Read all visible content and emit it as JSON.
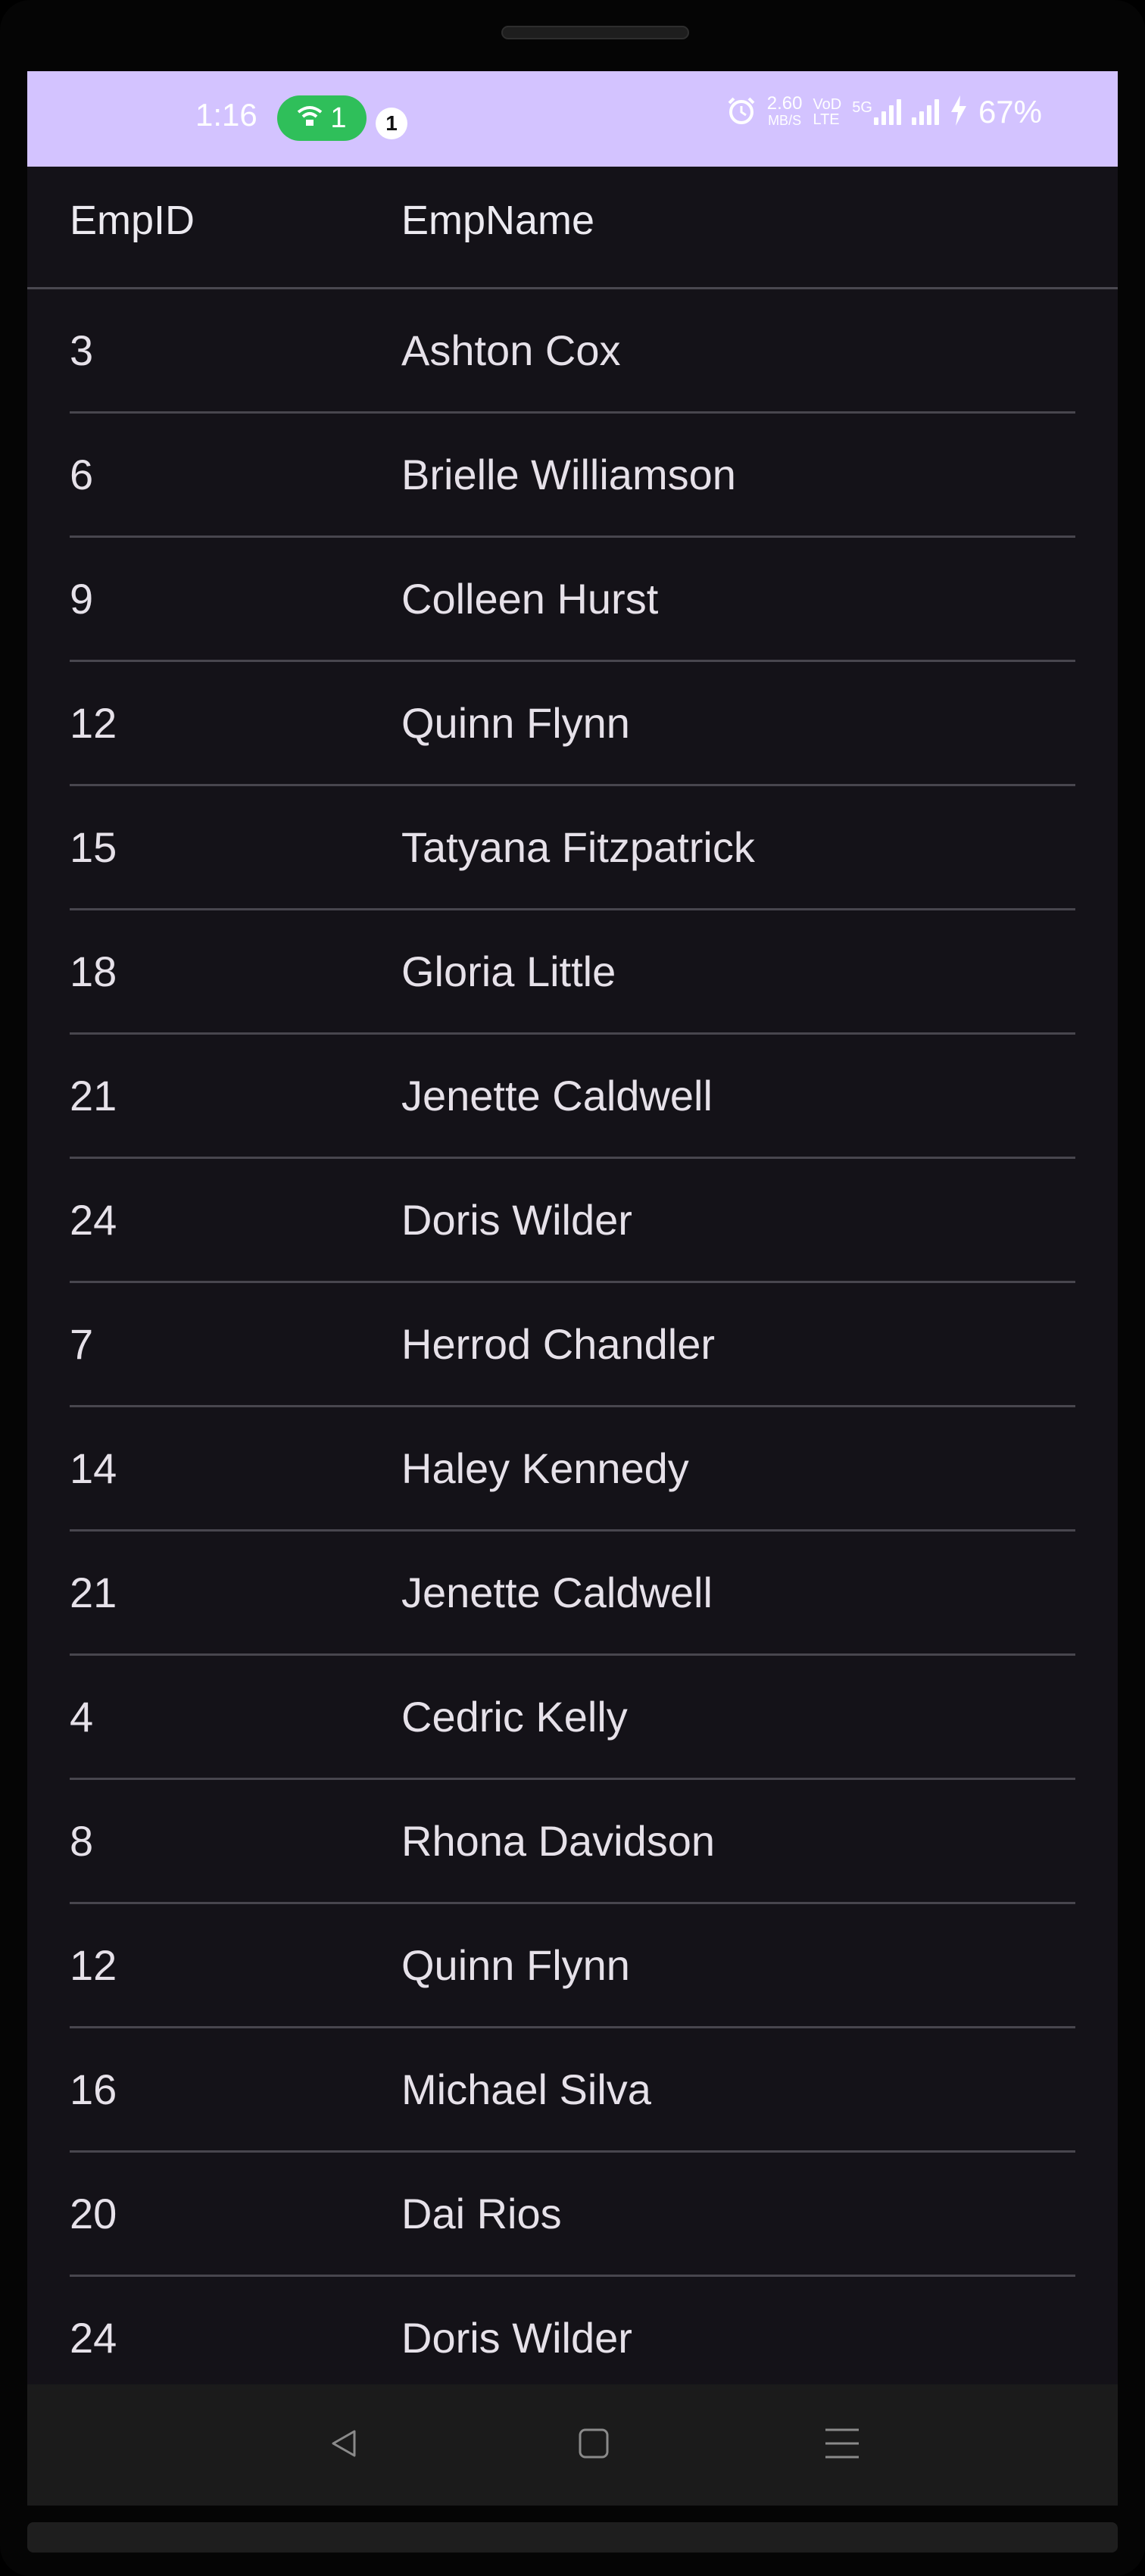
{
  "status_bar": {
    "time": "1:16",
    "wifi_count": "1",
    "notification_count": "1",
    "net_speed_value": "2.60",
    "net_speed_unit": "MB/S",
    "volte_top": "VoD",
    "volte_bottom": "LTE",
    "network_type": "5G",
    "battery": "67%"
  },
  "table": {
    "columns": [
      "EmpID",
      "EmpName"
    ],
    "rows": [
      {
        "id": "3",
        "name": "Ashton Cox"
      },
      {
        "id": "6",
        "name": "Brielle Williamson"
      },
      {
        "id": "9",
        "name": "Colleen Hurst"
      },
      {
        "id": "12",
        "name": "Quinn Flynn"
      },
      {
        "id": "15",
        "name": "Tatyana Fitzpatrick"
      },
      {
        "id": "18",
        "name": "Gloria Little"
      },
      {
        "id": "21",
        "name": "Jenette Caldwell"
      },
      {
        "id": "24",
        "name": "Doris Wilder"
      },
      {
        "id": "7",
        "name": "Herrod Chandler"
      },
      {
        "id": "14",
        "name": "Haley Kennedy"
      },
      {
        "id": "21",
        "name": "Jenette Caldwell"
      },
      {
        "id": "4",
        "name": "Cedric Kelly"
      },
      {
        "id": "8",
        "name": "Rhona Davidson"
      },
      {
        "id": "12",
        "name": "Quinn Flynn"
      },
      {
        "id": "16",
        "name": "Michael Silva"
      },
      {
        "id": "20",
        "name": "Dai Rios"
      },
      {
        "id": "24",
        "name": "Doris Wilder"
      }
    ]
  },
  "nav_bar": {
    "buttons": [
      "back-icon",
      "home-icon",
      "menu-icon"
    ]
  },
  "colors": {
    "status_bar": "#d3c3ff",
    "background": "#141218",
    "wifi_pill": "#2fbf5a"
  }
}
